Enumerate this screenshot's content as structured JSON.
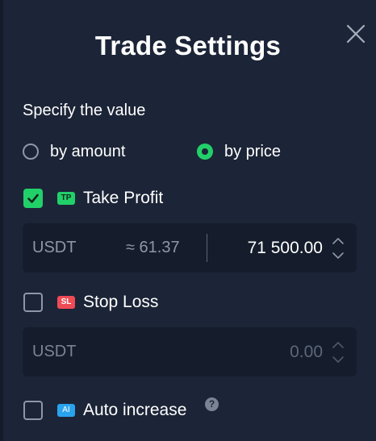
{
  "dialog": {
    "title": "Trade Settings"
  },
  "specify": {
    "label": "Specify the value",
    "options": [
      {
        "label": "by amount",
        "selected": false
      },
      {
        "label": "by price",
        "selected": true
      }
    ]
  },
  "take_profit": {
    "badge": "TP",
    "label": "Take Profit",
    "checked": true,
    "currency": "USDT",
    "approx": "≈ 61.37",
    "value": "71 500.00"
  },
  "stop_loss": {
    "badge": "SL",
    "label": "Stop Loss",
    "checked": false,
    "currency": "USDT",
    "value": "0.00"
  },
  "auto_increase": {
    "badge": "AI",
    "label": "Auto increase",
    "checked": false,
    "help": "?"
  },
  "colors": {
    "background": "#1c2537",
    "field": "#151d2c",
    "accent_green": "#22d06a",
    "stop_loss_red": "#ef4b55",
    "ai_blue": "#2aa3ee"
  },
  "icons": {
    "close": "close-icon",
    "check": "check-icon",
    "up": "chevron-up-icon",
    "down": "chevron-down-icon",
    "help": "question-icon"
  }
}
